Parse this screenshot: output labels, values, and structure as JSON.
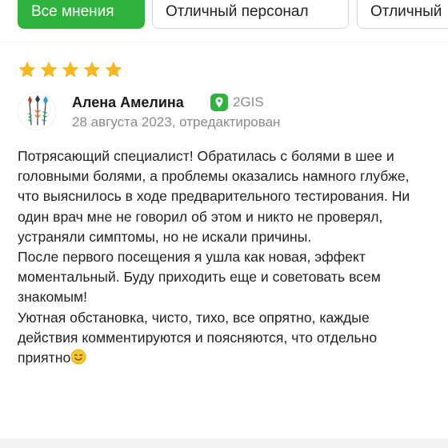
{
  "filters": [
    {
      "label": "Все мнения",
      "active": true
    },
    {
      "label": "Отличный персонал",
      "active": false
    },
    {
      "label": "Отличный",
      "active": false
    }
  ],
  "review": {
    "rating": 5,
    "author": "Алена Амелина",
    "source": "2GIS",
    "date": "28 августа 2023, отредактирован",
    "text_main": "Потрясающий специалист! Обратилась с болями в шее и головными болями, а проблемы оказались намного глубже, что выяснилось в ходе предварительного тестирования. Ни один врач мне не говорил об этом и никто не проверял, устраняли симптомы, но не искали причины.\nПосле первого посещения я ушла как новая, эффект моментальный. Буду приходить еще и советовать всем знакомым!\nУютная обстановка, чисто, тихо, все опрятно, каждые действия комментируются и поясняются, что отдельно приятно",
    "text_emoji": "smiling-face-emoji"
  },
  "colors": {
    "accent_green": "#2fb33e",
    "star_gold": "#f6b81f",
    "muted_text": "#8a8a8a"
  },
  "icons": {
    "star": "star-icon",
    "source": "2gis-icon",
    "avatar": "feathers-avatar"
  }
}
